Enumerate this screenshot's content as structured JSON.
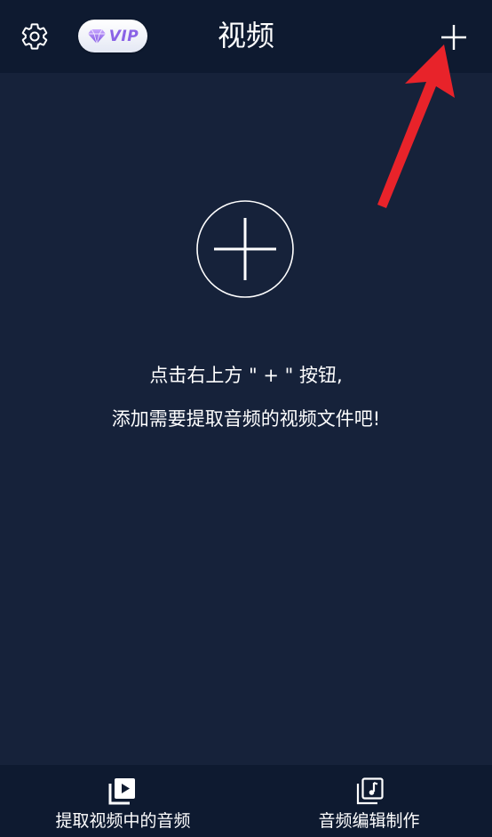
{
  "header": {
    "title": "视频",
    "vip_label": "VIP",
    "settings_icon": "gear-icon",
    "add_icon": "plus-icon"
  },
  "main": {
    "add_icon": "plus-circle-icon",
    "hint_line1": "点击右上方 \" + \" 按钮,",
    "hint_line2": "添加需要提取音频的视频文件吧!"
  },
  "bottom_nav": {
    "items": [
      {
        "label": "提取视频中的音频",
        "icon": "video-play-icon",
        "active": true
      },
      {
        "label": "音频编辑制作",
        "icon": "music-note-icon",
        "active": false
      }
    ]
  },
  "colors": {
    "background": "#16223a",
    "bar_background": "#0e1a30",
    "text": "#ffffff",
    "vip_accent": "#8a63e6",
    "annotation": "#e8232a"
  }
}
